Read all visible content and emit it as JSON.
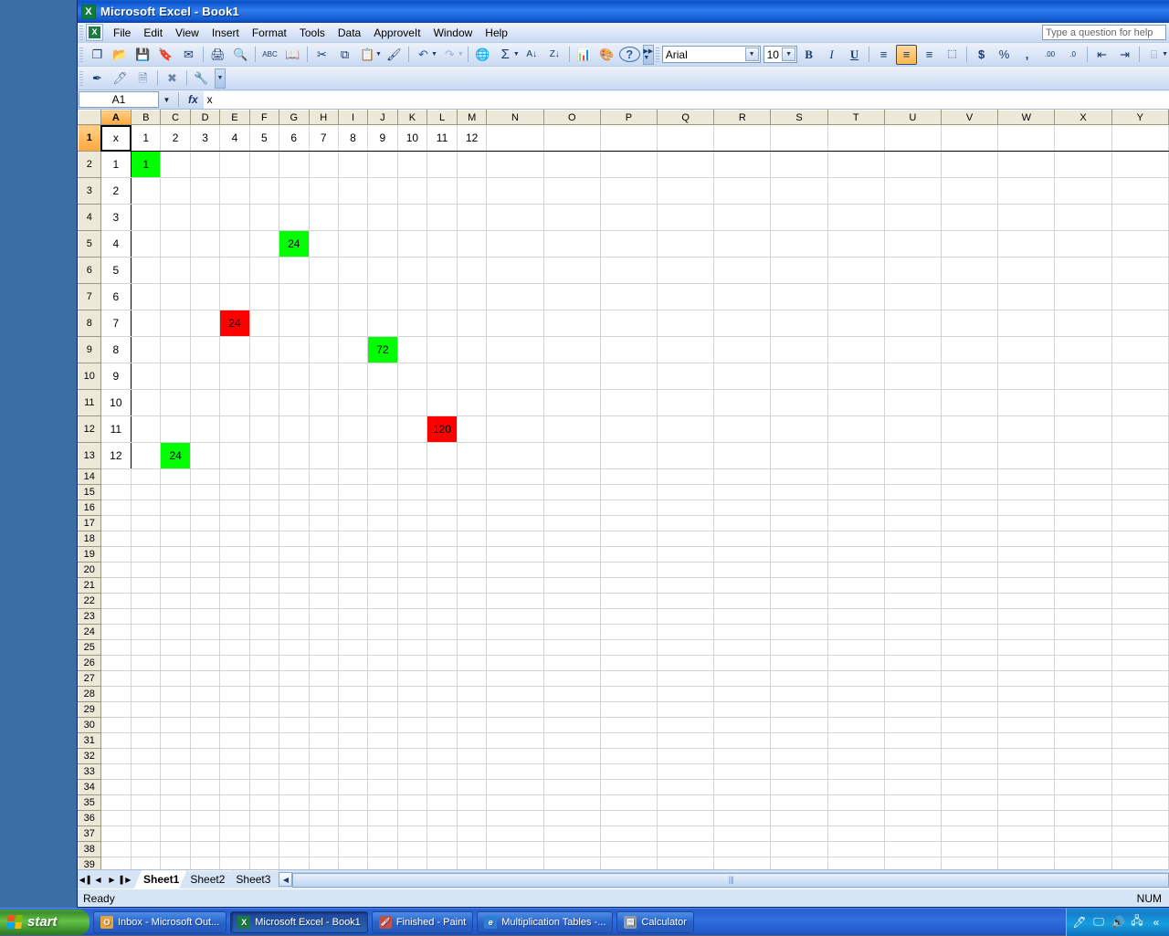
{
  "window": {
    "title": "Microsoft Excel - Book1",
    "app_icon": "excel-icon"
  },
  "menubar": {
    "items": [
      "File",
      "Edit",
      "View",
      "Insert",
      "Format",
      "Tools",
      "Data",
      "ApproveIt",
      "Window",
      "Help"
    ],
    "help_placeholder": "Type a question for help"
  },
  "toolbars": {
    "standard": [
      {
        "icon": "new-document-icon",
        "glyph": "❐"
      },
      {
        "icon": "open-folder-icon",
        "glyph": "📂"
      },
      {
        "icon": "save-icon",
        "glyph": "💾"
      },
      {
        "icon": "permission-icon",
        "glyph": "🔖"
      },
      {
        "icon": "email-icon",
        "glyph": "✉"
      },
      {
        "icon": "print-icon",
        "glyph": "🖨"
      },
      {
        "icon": "print-preview-icon",
        "glyph": "🔍"
      },
      {
        "icon": "spelling-icon",
        "glyph": "ABC"
      },
      {
        "icon": "research-icon",
        "glyph": "📖"
      },
      {
        "icon": "cut-icon",
        "glyph": "✂"
      },
      {
        "icon": "copy-icon",
        "glyph": "⧉"
      },
      {
        "icon": "paste-icon",
        "glyph": "📋"
      },
      {
        "icon": "format-painter-icon",
        "glyph": "🖌"
      },
      {
        "icon": "undo-icon",
        "glyph": "↶"
      },
      {
        "icon": "redo-icon",
        "glyph": "↷"
      },
      {
        "icon": "hyperlink-icon",
        "glyph": "🌐"
      },
      {
        "icon": "autosum-icon",
        "glyph": "Σ"
      },
      {
        "icon": "sort-ascending-icon",
        "glyph": "A↓"
      },
      {
        "icon": "sort-descending-icon",
        "glyph": "Z↓"
      },
      {
        "icon": "chart-wizard-icon",
        "glyph": "📊"
      },
      {
        "icon": "drawing-icon",
        "glyph": "🎨"
      },
      {
        "icon": "help-icon",
        "glyph": "?"
      }
    ],
    "approveit": [
      {
        "icon": "sign-pen-icon",
        "glyph": "✒"
      },
      {
        "icon": "approve-stamp-icon",
        "glyph": "🖊"
      },
      {
        "icon": "approve-pages-icon",
        "glyph": "🗎"
      },
      {
        "icon": "clear-signature-icon",
        "glyph": "✖"
      },
      {
        "icon": "settings-wrench-icon",
        "glyph": "🔧"
      }
    ],
    "formatting": {
      "font_name": "Arial",
      "font_size": "10",
      "bold_label": "B",
      "italic_label": "I",
      "underline_label": "U",
      "align_left": "≡",
      "align_center": "≡",
      "align_right": "≡",
      "merge_center": "⬚",
      "currency": "$",
      "percent": "%",
      "comma": ",",
      "increase_decimal": ".00",
      "decrease_decimal": ".0",
      "decrease_indent": "⇤",
      "increase_indent": "⇥",
      "borders": "⌸",
      "active_button": "align-center"
    }
  },
  "formula_bar": {
    "name_box": "A1",
    "fx_label": "fx",
    "formula_value": "x"
  },
  "grid": {
    "column_headers": [
      "A",
      "B",
      "C",
      "D",
      "E",
      "F",
      "G",
      "H",
      "I",
      "J",
      "K",
      "L",
      "M",
      "N",
      "O",
      "P",
      "Q",
      "R",
      "S",
      "T",
      "U",
      "V",
      "W",
      "X",
      "Y"
    ],
    "selected_column": "A",
    "selected_row": 1,
    "active_cell": "A1",
    "row_count_visible": 39,
    "data_rows": [
      {
        "row": 1,
        "A": "x",
        "B": "1",
        "C": "2",
        "D": "3",
        "E": "4",
        "F": "5",
        "G": "6",
        "H": "7",
        "I": "8",
        "J": "9",
        "K": "10",
        "L": "11",
        "M": "12"
      },
      {
        "row": 2,
        "A": "1",
        "B": "1"
      },
      {
        "row": 3,
        "A": "2"
      },
      {
        "row": 4,
        "A": "3"
      },
      {
        "row": 5,
        "A": "4",
        "G": "24"
      },
      {
        "row": 6,
        "A": "5"
      },
      {
        "row": 7,
        "A": "6"
      },
      {
        "row": 8,
        "A": "7",
        "E": "24"
      },
      {
        "row": 9,
        "A": "8",
        "J": "72"
      },
      {
        "row": 10,
        "A": "9"
      },
      {
        "row": 11,
        "A": "10"
      },
      {
        "row": 12,
        "A": "11",
        "L": "120"
      },
      {
        "row": 13,
        "A": "12",
        "C": "24"
      }
    ],
    "highlighted_cells": [
      {
        "cell": "B2",
        "value": "1",
        "fill": "#00ff00",
        "fill_name": "green"
      },
      {
        "cell": "G5",
        "value": "24",
        "fill": "#00ff00",
        "fill_name": "green"
      },
      {
        "cell": "E8",
        "value": "24",
        "fill": "#ff0000",
        "fill_name": "red"
      },
      {
        "cell": "J9",
        "value": "72",
        "fill": "#00ff00",
        "fill_name": "green"
      },
      {
        "cell": "L12",
        "value": "120",
        "fill": "#ff0000",
        "fill_name": "red"
      },
      {
        "cell": "C13",
        "value": "24",
        "fill": "#00ff00",
        "fill_name": "green"
      }
    ]
  },
  "sheet_tabs": {
    "tabs": [
      "Sheet1",
      "Sheet2",
      "Sheet3"
    ],
    "active": "Sheet1",
    "nav_first": "◀▐",
    "nav_prev": "◀",
    "nav_next": "▶",
    "nav_last": "▌▶"
  },
  "status_bar": {
    "status": "Ready",
    "num_lock": "NUM"
  },
  "taskbar": {
    "start_label": "start",
    "buttons": [
      {
        "label": "Inbox - Microsoft Out...",
        "icon": "outlook-icon",
        "icon_glyph": "O",
        "icon_color": "#e8a33d",
        "active": false
      },
      {
        "label": "Microsoft Excel - Book1",
        "icon": "excel-icon",
        "icon_glyph": "X",
        "icon_color": "#1a7a44",
        "active": true
      },
      {
        "label": "Finished - Paint",
        "icon": "paint-icon",
        "icon_glyph": "🖌",
        "icon_color": "#c0504d",
        "active": false
      },
      {
        "label": "Multiplication Tables -...",
        "icon": "internet-explorer-icon",
        "icon_glyph": "e",
        "icon_color": "#2f7fd1",
        "active": false
      },
      {
        "label": "Calculator",
        "icon": "calculator-icon",
        "icon_glyph": "▤",
        "icon_color": "#8f9ba8",
        "active": false
      }
    ],
    "tray_icons": [
      {
        "name": "pen-tray-icon",
        "glyph": "🖊"
      },
      {
        "name": "display-tray-icon",
        "glyph": "🖵"
      },
      {
        "name": "volume-tray-icon",
        "glyph": "🔊"
      },
      {
        "name": "network-tray-icon",
        "glyph": "🖧"
      },
      {
        "name": "show-hidden-icons-icon",
        "glyph": "«"
      }
    ]
  },
  "colors": {
    "highlight_green": "#00ff00",
    "highlight_red": "#ff0000",
    "header_selected": "#ffa73c",
    "titlebar_blue": "#0a52c8"
  }
}
